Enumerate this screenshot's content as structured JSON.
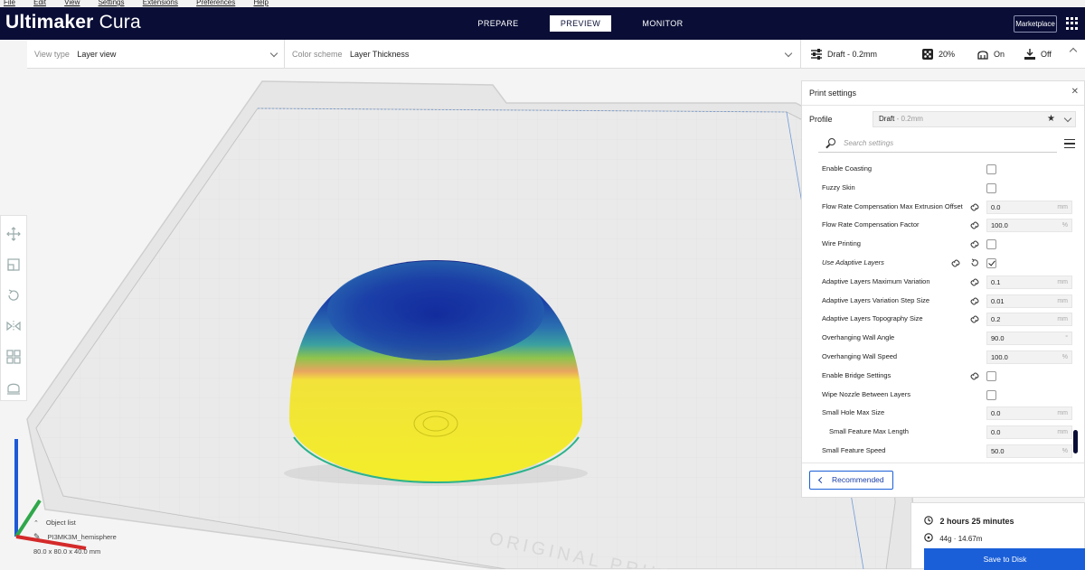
{
  "menu": [
    "File",
    "Edit",
    "View",
    "Settings",
    "Extensions",
    "Preferences",
    "Help"
  ],
  "app": {
    "brand_bold": "Ultimaker",
    "brand_thin": "Cura"
  },
  "stages": [
    {
      "label": "PREPARE",
      "active": false
    },
    {
      "label": "PREVIEW",
      "active": true
    },
    {
      "label": "MONITOR",
      "active": false
    }
  ],
  "header": {
    "marketplace_label": "Marketplace"
  },
  "view_bar": {
    "view_type_label": "View type",
    "view_type_value": "Layer view",
    "color_scheme_label": "Color scheme",
    "color_scheme_value": "Layer Thickness"
  },
  "settings_bar": {
    "profile": "Draft - 0.2mm",
    "infill": "20%",
    "support": "On",
    "adhesion": "Off"
  },
  "print_settings": {
    "title": "Print settings",
    "profile_label": "Profile",
    "profile_value": "Draft",
    "profile_sub": " - 0.2mm",
    "search_placeholder": "Search settings",
    "rows": [
      {
        "name": "Enable Coasting",
        "type": "check",
        "checked": false
      },
      {
        "name": "Fuzzy Skin",
        "type": "check",
        "checked": false
      },
      {
        "name": "Flow Rate Compensation Max Extrusion Offset",
        "type": "field",
        "value": "0.0",
        "unit": "mm",
        "linked": true
      },
      {
        "name": "Flow Rate Compensation Factor",
        "type": "field",
        "value": "100.0",
        "unit": "%",
        "linked": true
      },
      {
        "name": "Wire Printing",
        "type": "check",
        "checked": false,
        "linked": true
      },
      {
        "name": "Use Adaptive Layers",
        "type": "check",
        "checked": true,
        "linked": true,
        "reset": true,
        "italic": true
      },
      {
        "name": "Adaptive Layers Maximum Variation",
        "type": "field",
        "value": "0.1",
        "unit": "mm",
        "linked": true
      },
      {
        "name": "Adaptive Layers Variation Step Size",
        "type": "field",
        "value": "0.01",
        "unit": "mm",
        "linked": true
      },
      {
        "name": "Adaptive Layers Topography Size",
        "type": "field",
        "value": "0.2",
        "unit": "mm",
        "linked": true
      },
      {
        "name": "Overhanging Wall Angle",
        "type": "field",
        "value": "90.0",
        "unit": "°"
      },
      {
        "name": "Overhanging Wall Speed",
        "type": "field",
        "value": "100.0",
        "unit": "%"
      },
      {
        "name": "Enable Bridge Settings",
        "type": "check",
        "checked": false,
        "linked": true
      },
      {
        "name": "Wipe Nozzle Between Layers",
        "type": "check",
        "checked": false
      },
      {
        "name": "Small Hole Max Size",
        "type": "field",
        "value": "0.0",
        "unit": "mm"
      },
      {
        "name": "Small Feature Max Length",
        "type": "field",
        "value": "0.0",
        "unit": "mm",
        "indent": true
      },
      {
        "name": "Small Feature Speed",
        "type": "field",
        "value": "50.0",
        "unit": "%"
      }
    ],
    "recommended_label": "Recommended"
  },
  "print_info": {
    "time": "2 hours 25 minutes",
    "material": "44g · 14.67m",
    "save_label": "Save to Disk"
  },
  "object_info": {
    "object_list_label": "Object list",
    "object_name": "PI3MK3M_hemisphere",
    "dimensions": "80.0 x 80.0 x 40.0 mm"
  },
  "bed_text": "ORIGINAL PRUSA",
  "icons": {
    "toolbar": [
      "move-icon",
      "scale-icon",
      "rotate-icon",
      "mirror-icon",
      "per-model-settings-icon",
      "support-blocker-icon"
    ]
  }
}
